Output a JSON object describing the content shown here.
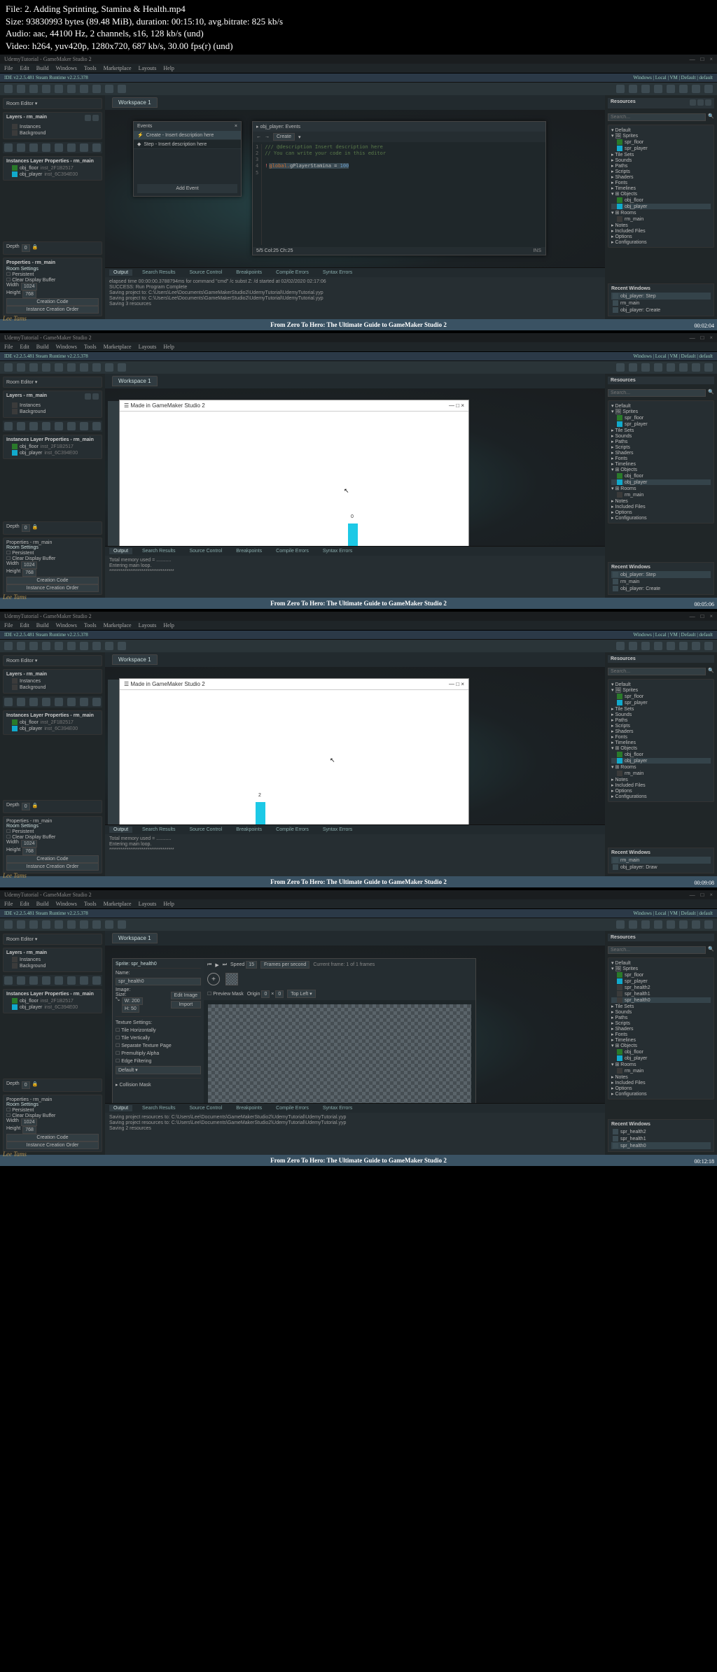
{
  "meta": {
    "file": "File: 2. Adding Sprinting, Stamina & Health.mp4",
    "size": "Size: 93830993 bytes (89.48 MiB), duration: 00:15:10, avg.bitrate: 825 kb/s",
    "audio": "Audio: aac, 44100 Hz, 2 channels, s16, 128 kb/s (und)",
    "video": "Video: h264, yuv420p, 1280x720, 687 kb/s, 30.00 fps(r) (und)"
  },
  "common": {
    "title_left": "UdemyTutorial - GameMaker Studio 2",
    "win_buttons": [
      "—",
      "□",
      "×"
    ],
    "menu": [
      "File",
      "Edit",
      "Build",
      "Windows",
      "Tools",
      "Marketplace",
      "Layouts",
      "Help"
    ],
    "version_left": "IDE v2.2.5.481 Steam  Runtime v2.2.5.378",
    "version_right": "Windows | Local | VM | Default | default",
    "room_editor": "Room Editor",
    "layers_label": "Layers - rm_main",
    "layers": [
      "Instances",
      "Background"
    ],
    "ilp_label": "Instances Layer Properties - rm_main",
    "ilp_rows": [
      {
        "obj": "obj_floor",
        "inst": "inst_2F1B2517"
      },
      {
        "obj": "obj_player",
        "inst": "inst_6C394E00"
      }
    ],
    "depth_label": "Depth",
    "depth_val": "0",
    "properties_label": "Properties - rm_main",
    "room_settings": "Room Settings",
    "persistent": "Persistent",
    "clear_display_buffer": "Clear Display Buffer",
    "width_label": "Width",
    "width_val": "1024",
    "height_label": "Height",
    "height_val": "768",
    "creation_code": "Creation Code",
    "instance_order": "Instance Creation Order",
    "resources_label": "Resources",
    "game_options": "Default",
    "sprites": "Sprites",
    "tile_sets": "Tile Sets",
    "sounds": "Sounds",
    "paths": "Paths",
    "scripts": "Scripts",
    "shaders": "Shaders",
    "fonts": "Fonts",
    "timelines": "Timelines",
    "objects": "Objects",
    "rooms": "Rooms",
    "notes": "Notes",
    "ext": "Included Files",
    "options": "Options",
    "configs": "Configurations",
    "search_ph": "Search...",
    "recent_windows": "Recent Windows",
    "footer": "From Zero To Hero: The Ultimate Guide to GameMaker Studio 2",
    "watermark": "Lee Tams",
    "output_tabs": [
      "Output",
      "Search Results",
      "Source Control",
      "Breakpoints",
      "Compile Errors",
      "Syntax Errors"
    ],
    "workspace_tab": "Workspace 1"
  },
  "shot1": {
    "events_title": "Events",
    "ev_create": "Create - Insert description here",
    "ev_step": "Step - Insert description here",
    "add_event": "Add Event",
    "code_title": "obj_player: Events",
    "code_tab": "Create",
    "code_lines": [
      {
        "n": "1",
        "cls": "cl-comment",
        "t": "/// @description Insert description here"
      },
      {
        "n": "2",
        "cls": "cl-comment",
        "t": "// You can write your code in this editor"
      },
      {
        "n": "3",
        "cls": "",
        "t": ""
      },
      {
        "n": "4",
        "cls": "",
        "t": "global.gPlayerStamina = 100"
      }
    ],
    "cursor_status": "5/5 Col:25 Ch:25",
    "ins": "INS",
    "output": "elapsed time 00:00:00.3788794ms for command \"cmd\" /c subst Z: /d started at 02/02/2020 02:17:06\nSUCCESS: Run Program Complete\nSaving project to: C:\\Users\\Lee\\Documents\\GameMakerStudio2\\UdemyTutorial\\UdemyTutorial.yyp\nSaving project to: C:\\Users\\Lee\\Documents\\GameMakerStudio2\\UdemyTutorial\\UdemyTutorial.yyp\nSaving 3 resources",
    "spr_list": [
      "spr_floor",
      "spr_player"
    ],
    "obj_list": [
      "obj_floor",
      "obj_player"
    ],
    "rm_main": "rm_main",
    "recent": [
      "obj_player: Step",
      "rm_main",
      "obj_player: Create"
    ],
    "timestamp": "00:02:04"
  },
  "shot2": {
    "game_title": "☰ Made in GameMaker Studio 2",
    "player_num": "0",
    "output": "Total memory used = ...........\nEntering main loop.\n**********************************",
    "spr_list": [
      "spr_floor",
      "spr_player"
    ],
    "obj_list": [
      "obj_floor",
      "obj_player"
    ],
    "recent": [
      "obj_player: Step",
      "rm_main",
      "obj_player: Create"
    ],
    "timestamp": "00:05:06"
  },
  "shot3": {
    "game_title": "☰ Made in GameMaker Studio 2",
    "player_num": "2",
    "output": "Total memory used = ...........\nEntering main loop.\n**********************************",
    "spr_list": [
      "spr_floor",
      "spr_player"
    ],
    "obj_list": [
      "obj_floor",
      "obj_player"
    ],
    "recent": [
      "rm_main",
      "obj_player: Draw"
    ],
    "timestamp": "00:09:08"
  },
  "shot4": {
    "sprite_title": "Sprite: spr_health0",
    "name_label": "Name:",
    "name_val": "spr_health0",
    "image_label": "Image:",
    "size_label": "Size:",
    "w": "W: 200",
    "h": "H: 50",
    "edit_image": "Edit Image",
    "import": "Import",
    "tex_settings": "Texture Settings:",
    "tile_h": "Tile Horizontally",
    "tile_v": "Tile Vertically",
    "sep_tex": "Separate Texture Page",
    "premul": "Premultiply Alpha",
    "edge": "Edge Filtering",
    "default": "Default",
    "coll_mask": "Collision Mask",
    "speed_label": "Speed",
    "speed_val": "15",
    "fps": "Frames per second",
    "cur_frame": "Current frame: 1 of 1 frames",
    "preview_mask": "Preview Mask",
    "origin": "Origin",
    "ox": "0",
    "oy": "0",
    "top_left": "Top Left",
    "spr_list": [
      "spr_floor",
      "spr_player",
      "spr_health2",
      "spr_health1",
      "spr_health0"
    ],
    "obj_list": [
      "obj_floor",
      "obj_player"
    ],
    "output": "Saving project resources to: C:\\Users\\Lee\\Documents\\GameMakerStudio2\\UdemyTutorial\\UdemyTutorial.yyp\nSaving project resources to: C:\\Users\\Lee\\Documents\\GameMakerStudio2\\UdemyTutorial\\UdemyTutorial.yyp\nSaving 2 resources",
    "recent": [
      "spr_health2",
      "spr_health1",
      "spr_health0"
    ],
    "timestamp": "00:12:18"
  }
}
